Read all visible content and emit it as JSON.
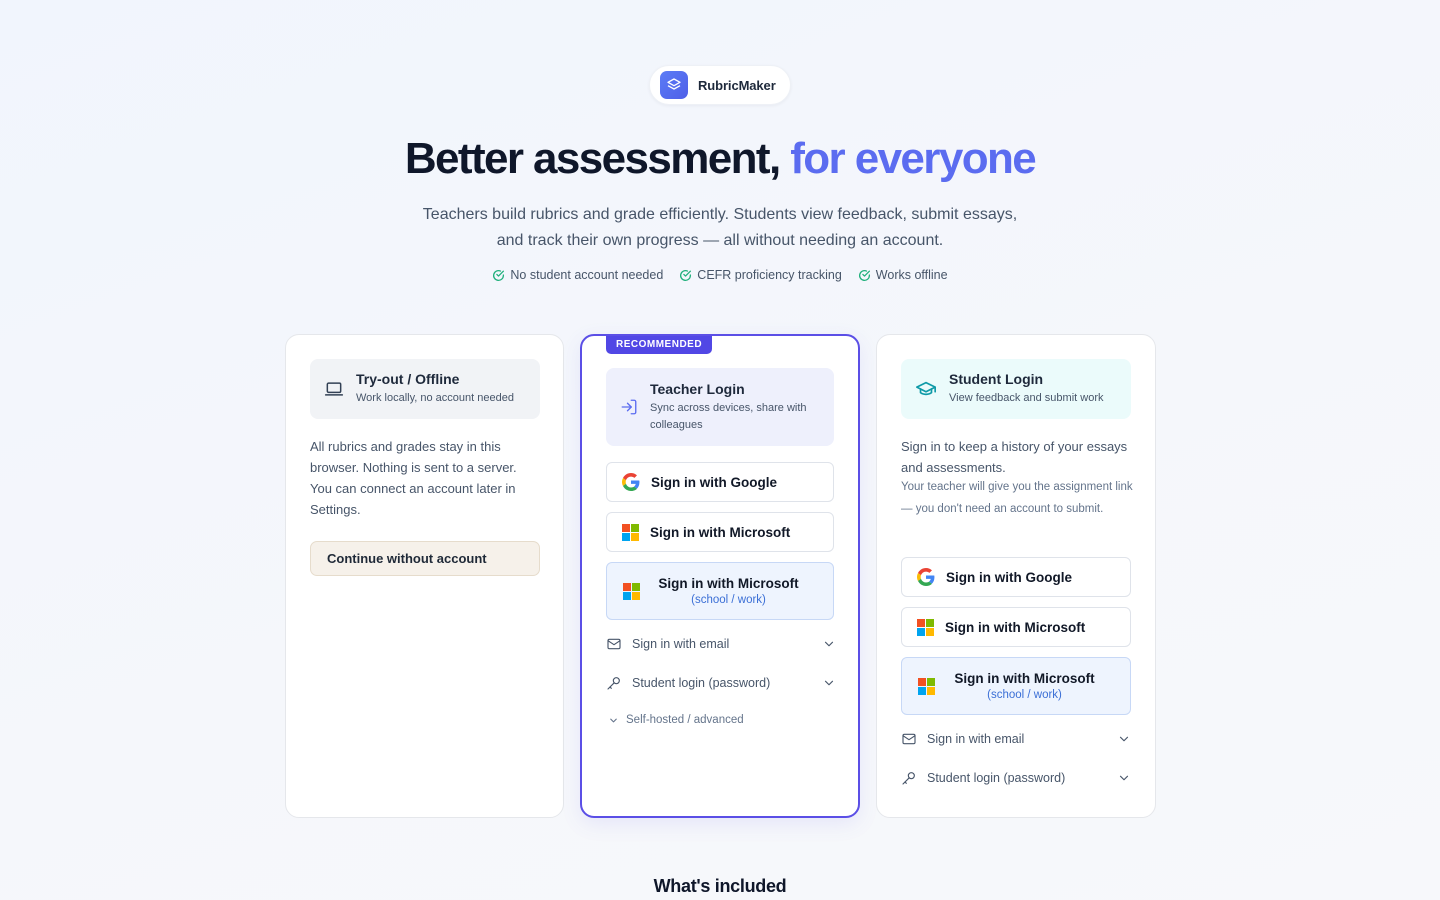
{
  "brand": {
    "name": "RubricMaker"
  },
  "hero": {
    "title_main": "Better assessment,",
    "title_accent": "for everyone",
    "subtitle": "Teachers build rubrics and grade efficiently. Students view feedback, submit essays, and track their own progress — all without needing an account.",
    "features": [
      "No student account needed",
      "CEFR proficiency tracking",
      "Works offline"
    ]
  },
  "offline_card": {
    "title": "Try-out / Offline",
    "subtitle": "Work locally, no account needed",
    "description": "All rubrics and grades stay in this browser. Nothing is sent to a server. You can connect an account later in Settings.",
    "continue_label": "Continue without account"
  },
  "teacher_card": {
    "badge": "RECOMMENDED",
    "title": "Teacher Login",
    "subtitle": "Sync across devices, share with colleagues",
    "google_label": "Sign in with Google",
    "microsoft_label": "Sign in with Microsoft",
    "microsoft_school_label": "Sign in with Microsoft",
    "microsoft_school_sub": "(school / work)",
    "email_label": "Sign in with email",
    "student_password_label": "Student login (password)",
    "advanced_label": "Self-hosted / advanced"
  },
  "student_card": {
    "title": "Student Login",
    "subtitle": "View feedback and submit work",
    "description": "Sign in to keep a history of your essays and assessments.",
    "note": "Your teacher will give you the assignment link — you don't need an account to submit.",
    "google_label": "Sign in with Google",
    "microsoft_label": "Sign in with Microsoft",
    "microsoft_school_label": "Sign in with Microsoft",
    "microsoft_school_sub": "(school / work)",
    "email_label": "Sign in with email",
    "student_password_label": "Student login (password)"
  },
  "section": {
    "title": "What's included"
  },
  "colors": {
    "accent": "#5b6cf0",
    "recommended": "#5147e5",
    "check_green": "#22b07d",
    "teal_icon": "#0e9aa7"
  }
}
